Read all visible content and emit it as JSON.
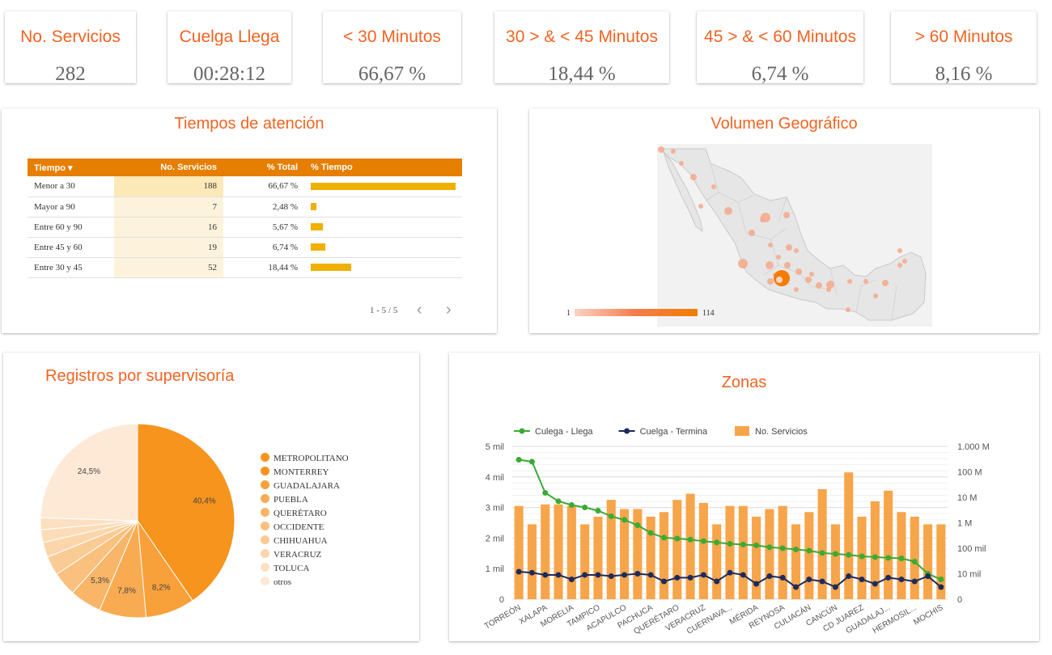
{
  "kpis": [
    {
      "title": "No. Servicios",
      "value": "282"
    },
    {
      "title": "Cuelga Llega",
      "value": "00:28:12"
    },
    {
      "title": "< 30 Minutos",
      "value": "66,67 %"
    },
    {
      "title": "30 > & < 45 Minutos",
      "value": "18,44 %"
    },
    {
      "title": "45 > & < 60 Minutos",
      "value": "6,74 %"
    },
    {
      "title": "> 60 Minutos",
      "value": "8,16 %"
    }
  ],
  "tiempos": {
    "title": "Tiempos de atención",
    "headers": {
      "tiempo": "Tiempo",
      "sort_icon": "▾",
      "servicios": "No. Servicios",
      "total": "% Total",
      "pct": "% Tiempo"
    },
    "rows": [
      {
        "label": "Menor a 30",
        "servicios": "188",
        "total": "66,67 %",
        "pct": 66.67
      },
      {
        "label": "Mayor a 90",
        "servicios": "7",
        "total": "2,48 %",
        "pct": 2.48
      },
      {
        "label": "Entre 60 y 90",
        "servicios": "16",
        "total": "5,67 %",
        "pct": 5.67
      },
      {
        "label": "Entre 45 y 60",
        "servicios": "19",
        "total": "6,74 %",
        "pct": 6.74
      },
      {
        "label": "Entre 30 y 45",
        "servicios": "52",
        "total": "18,44 %",
        "pct": 18.44
      }
    ],
    "pager": "1 - 5 / 5",
    "prev_icon": "‹",
    "next_icon": "›"
  },
  "geo": {
    "title": "Volumen Geográfico",
    "scale_min": "1",
    "scale_max": "114",
    "colors": {
      "land": "#e8e8e8",
      "border": "#c8c8c8",
      "bubble": "#f5a88a",
      "bubble_max": "#f57c00"
    }
  },
  "supervisoria": {
    "title": "Registros por supervisoría",
    "legend": [
      "METROPOLITANO",
      "MONTERREY",
      "GUADALAJARA",
      "PUEBLA",
      "QUERÉTARO",
      "OCCIDENTE",
      "CHIHUAHUA",
      "VERACRUZ",
      "TOLUCA",
      "otros"
    ],
    "legend_colors": [
      "#f7941d",
      "#f7941d",
      "#f8a03a",
      "#f9ab52",
      "#f9b568",
      "#fac07e",
      "#fbcb95",
      "#fcd6ab",
      "#fde0c1",
      "#fde9d6"
    ]
  },
  "zonas": {
    "title": "Zonas",
    "legend": [
      {
        "label": "Culega - Llega",
        "color": "#3aaa35",
        "kind": "line"
      },
      {
        "label": "Cuelga - Termina",
        "color": "#1b2b5e",
        "kind": "line"
      },
      {
        "label": "No. Servicios",
        "color": "#f7a54a",
        "kind": "bar"
      }
    ],
    "left_ticks": [
      "0",
      "1 mil",
      "2 mil",
      "3 mil",
      "4 mil",
      "5 mil"
    ],
    "right_ticks": [
      "0",
      "10 mil",
      "100 mil",
      "1 M",
      "10 M",
      "100 M",
      "1.000 M"
    ],
    "x_labels": [
      "TORREÓN",
      "XALAPA",
      "MORELIA",
      "TAMPICO",
      "ACAPULCO",
      "PACHUCA",
      "QUERÉTARO",
      "VERACRUZ",
      "CUERNAVA...",
      "MÉRIDA",
      "REYNOSA",
      "CULIACÁN",
      "CANCÚN",
      "CD JUAREZ",
      "GUADALAJ...",
      "HERMOSIL...",
      "MOCHIS"
    ]
  },
  "chart_data": [
    {
      "type": "pie",
      "title": "Registros por supervisoría",
      "labels": [
        "METROPOLITANO",
        "MONTERREY",
        "GUADALAJARA",
        "PUEBLA",
        "QUERÉTARO",
        "OCCIDENTE",
        "CHIHUAHUA",
        "VERACRUZ",
        "TOLUCA",
        "otros"
      ],
      "values": [
        40.4,
        8.2,
        7.8,
        5.3,
        4.0,
        3.2,
        2.5,
        2.1,
        2.0,
        24.5
      ],
      "slice_labels": [
        "40,4%",
        "8,2%",
        "7,8%",
        "5,3%",
        "",
        "",
        "",
        "",
        "",
        "24,5%"
      ],
      "colors": [
        "#f7941d",
        "#f8a03a",
        "#f9ab52",
        "#f9b568",
        "#fac07e",
        "#fbcb95",
        "#fcd6ab",
        "#fcdcb8",
        "#fde0c1",
        "#fde9d6"
      ]
    },
    {
      "type": "bar",
      "title": "Zonas",
      "categories": [
        "TORREÓN",
        "",
        "XALAPA",
        "",
        "MORELIA",
        "",
        "TAMPICO",
        "",
        "ACAPULCO",
        "",
        "PACHUCA",
        "",
        "QUERÉTARO",
        "",
        "VERACRUZ",
        "",
        "CUERNAVA...",
        "",
        "MÉRIDA",
        "",
        "REYNOSA",
        "",
        "CULIACÁN",
        "",
        "CANCÚN",
        "",
        "CD JUAREZ",
        "",
        "GUADALAJ...",
        "",
        "HERMOSIL...",
        "",
        "MOCHIS"
      ],
      "ylim": [
        0,
        5000
      ],
      "ylim_right_log": [
        1000,
        1000000000
      ],
      "series": [
        {
          "name": "No. Servicios",
          "axis": "left",
          "kind": "bar",
          "values": [
            3050,
            2450,
            3100,
            3100,
            3050,
            2450,
            2700,
            3250,
            2950,
            2950,
            2700,
            2850,
            3250,
            3450,
            3150,
            2450,
            3050,
            3050,
            2700,
            2950,
            3050,
            2450,
            2850,
            3600,
            2450,
            4150,
            2700,
            3200,
            3550,
            2850,
            2700,
            2450,
            2450
          ]
        },
        {
          "name": "Culega - Llega",
          "axis": "right_log",
          "kind": "line",
          "values": [
            300000000,
            250000000,
            15000000,
            7000000,
            5000000,
            4000000,
            3000000,
            1800000,
            1300000,
            800000,
            400000,
            260000,
            240000,
            220000,
            190000,
            170000,
            150000,
            140000,
            130000,
            110000,
            100000,
            90000,
            80000,
            65000,
            60000,
            55000,
            48000,
            45000,
            42000,
            40000,
            30000,
            10000,
            6000
          ]
        },
        {
          "name": "Cuelga - Termina",
          "axis": "right_log",
          "kind": "line",
          "values": [
            12000,
            11000,
            9000,
            9000,
            6000,
            9000,
            9000,
            8000,
            9000,
            10000,
            9000,
            5000,
            7000,
            7000,
            9000,
            5000,
            11000,
            9000,
            4000,
            8000,
            7000,
            3000,
            6000,
            5000,
            3000,
            8000,
            6000,
            4000,
            7000,
            6000,
            5000,
            8000,
            3000
          ]
        }
      ]
    }
  ]
}
